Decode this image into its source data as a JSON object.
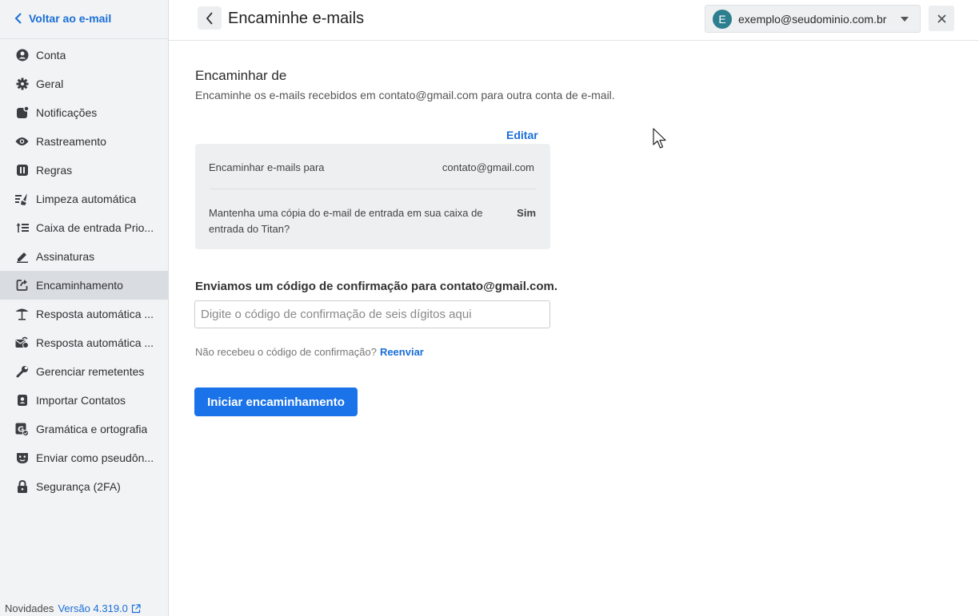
{
  "sidebar": {
    "back_label": "Voltar ao e-mail",
    "items": [
      {
        "label": "Conta",
        "icon": "account-icon"
      },
      {
        "label": "Geral",
        "icon": "gear-icon"
      },
      {
        "label": "Notificações",
        "icon": "notification-icon"
      },
      {
        "label": "Rastreamento",
        "icon": "eye-icon"
      },
      {
        "label": "Regras",
        "icon": "rules-icon"
      },
      {
        "label": "Limpeza automática",
        "icon": "broom-icon"
      },
      {
        "label": "Caixa de entrada Prio...",
        "icon": "priority-inbox-icon"
      },
      {
        "label": "Assinaturas",
        "icon": "pen-icon"
      },
      {
        "label": "Encaminhamento",
        "icon": "forward-icon",
        "active": true
      },
      {
        "label": "Resposta automática ...",
        "icon": "beach-umbrella-icon"
      },
      {
        "label": "Resposta automática ...",
        "icon": "auto-reply-icon"
      },
      {
        "label": "Gerenciar remetentes",
        "icon": "wrench-icon"
      },
      {
        "label": "Importar Contatos",
        "icon": "contacts-icon"
      },
      {
        "label": "Gramática e ortografia",
        "icon": "grammar-icon"
      },
      {
        "label": "Enviar como pseudôn...",
        "icon": "mask-icon"
      },
      {
        "label": "Segurança (2FA)",
        "icon": "lock-icon"
      }
    ],
    "footer": {
      "label": "Novidades",
      "version": "Versão 4.319.0"
    }
  },
  "header": {
    "title": "Encaminhe e-mails",
    "account": {
      "initial": "E",
      "email": "exemplo@seudominio.com.br"
    }
  },
  "main": {
    "section_title": "Encaminhar de",
    "section_desc": "Encaminhe os e-mails recebidos em contato@gmail.com para outra conta de e-mail.",
    "edit_label": "Editar",
    "card": {
      "row1_label": "Encaminhar e-mails para",
      "row1_value": "contato@gmail.com",
      "row2_label": "Mantenha uma cópia do e-mail de entrada em sua caixa de entrada do Titan?",
      "row2_value": "Sim"
    },
    "confirm_title": "Enviamos um código de confirmação para contato@gmail.com.",
    "code_placeholder": "Digite o código de confirmação de seis dígitos aqui",
    "resend_prompt": "Não recebeu o código de confirmação?",
    "resend_label": "Reenviar",
    "start_button": "Iniciar encaminhamento"
  },
  "colors": {
    "accent": "#1a73e8",
    "link": "#1a6fd6",
    "avatar": "#2d7f8f",
    "sidebar_bg": "#f2f3f4",
    "active_item": "#d9dce1"
  }
}
